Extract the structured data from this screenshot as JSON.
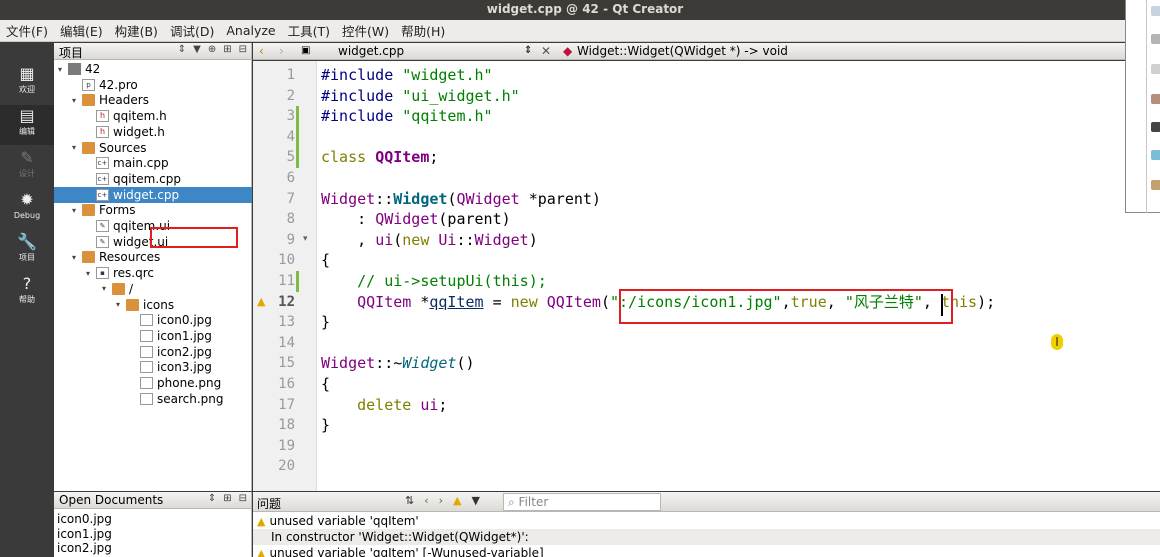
{
  "window": {
    "title": "widget.cpp @ 42 - Qt Creator"
  },
  "menubar": [
    "文件(F)",
    "编辑(E)",
    "构建(B)",
    "调试(D)",
    "Analyze",
    "工具(T)",
    "控件(W)",
    "帮助(H)"
  ],
  "modes": [
    {
      "label": "欢迎",
      "icon": "▦"
    },
    {
      "label": "编辑",
      "icon": "▤"
    },
    {
      "label": "设计",
      "icon": "✎"
    },
    {
      "label": "Debug",
      "icon": "✹"
    },
    {
      "label": "项目",
      "icon": "🔧"
    },
    {
      "label": "帮助",
      "icon": "?"
    }
  ],
  "project_panel": {
    "title": "项目",
    "tree": [
      {
        "label": "42",
        "kind": "proj",
        "depth": 0,
        "arrow": "▾"
      },
      {
        "label": "42.pro",
        "kind": "pro",
        "depth": 1,
        "arrow": ""
      },
      {
        "label": "Headers",
        "kind": "folder",
        "depth": 1,
        "arrow": "▾"
      },
      {
        "label": "qqitem.h",
        "kind": "h",
        "depth": 2,
        "arrow": ""
      },
      {
        "label": "widget.h",
        "kind": "h",
        "depth": 2,
        "arrow": ""
      },
      {
        "label": "Sources",
        "kind": "folder",
        "depth": 1,
        "arrow": "▾"
      },
      {
        "label": "main.cpp",
        "kind": "cpp",
        "depth": 2,
        "arrow": ""
      },
      {
        "label": "qqitem.cpp",
        "kind": "cpp",
        "depth": 2,
        "arrow": ""
      },
      {
        "label": "widget.cpp",
        "kind": "cpp",
        "depth": 2,
        "arrow": "",
        "selected": true
      },
      {
        "label": "Forms",
        "kind": "folder",
        "depth": 1,
        "arrow": "▾"
      },
      {
        "label": "qqitem.ui",
        "kind": "ui",
        "depth": 2,
        "arrow": ""
      },
      {
        "label": "widget.ui",
        "kind": "ui",
        "depth": 2,
        "arrow": ""
      },
      {
        "label": "Resources",
        "kind": "folder",
        "depth": 1,
        "arrow": "▾"
      },
      {
        "label": "res.qrc",
        "kind": "qrc",
        "depth": 2,
        "arrow": "▾"
      },
      {
        "label": "/",
        "kind": "folder",
        "depth": 3,
        "arrow": "▾"
      },
      {
        "label": "icons",
        "kind": "folder",
        "depth": 4,
        "arrow": "▾"
      },
      {
        "label": "icon0.jpg",
        "kind": "img",
        "depth": 5,
        "arrow": ""
      },
      {
        "label": "icon1.jpg",
        "kind": "img",
        "depth": 5,
        "arrow": ""
      },
      {
        "label": "icon2.jpg",
        "kind": "img",
        "depth": 5,
        "arrow": ""
      },
      {
        "label": "icon3.jpg",
        "kind": "img",
        "depth": 5,
        "arrow": ""
      },
      {
        "label": "phone.png",
        "kind": "img",
        "depth": 5,
        "arrow": ""
      },
      {
        "label": "search.png",
        "kind": "img",
        "depth": 5,
        "arrow": ""
      }
    ]
  },
  "editor": {
    "file": "widget.cpp",
    "symbol": "Widget::Widget(QWidget *) -> void",
    "current_line": 12,
    "lines": [
      {
        "n": "1",
        "html": "<span class='pp'>#include</span> <span class='str'>\"widget.h\"</span>"
      },
      {
        "n": "2",
        "html": "<span class='pp'>#include</span> <span class='str'>\"ui_widget.h\"</span>"
      },
      {
        "n": "3",
        "html": "<span class='pp'>#include</span> <span class='str'>\"qqitem.h\"</span>"
      },
      {
        "n": "4",
        "html": ""
      },
      {
        "n": "5",
        "html": "<span class='kw'>class</span> <span class='ty bold'>QQItem</span>;"
      },
      {
        "n": "6",
        "html": ""
      },
      {
        "n": "7",
        "html": "<span class='ty'>Widget</span>::<span class='fn'>Widget</span>(<span class='ty'>QWidget</span> *parent)"
      },
      {
        "n": "8",
        "html": "    : <span class='ty'>QWidget</span>(parent)"
      },
      {
        "n": "9",
        "html": "    , <span class='ty'>ui</span>(<span class='kw'>new</span> <span class='ty'>Ui</span>::<span class='ty'>Widget</span>)"
      },
      {
        "n": "10",
        "html": "{"
      },
      {
        "n": "11",
        "html": "    <span class='cm'>// ui->setupUi(this);</span>"
      },
      {
        "n": "12",
        "html": "    <span class='ty'>QQItem</span> *<span class='var'>qqItem</span> = <span class='kw'>new</span> <span class='ty'>QQItem</span>(<span class='str'>\":/icons/icon1.jpg\"</span>,<span class='kw'>true</span>, <span class='str'>\"风子兰特\"</span>, <span class='kw'>this</span>);"
      },
      {
        "n": "13",
        "html": "}"
      },
      {
        "n": "14",
        "html": ""
      },
      {
        "n": "15",
        "html": "<span class='ty'>Widget</span>::~<span class='it'>Widget</span>()"
      },
      {
        "n": "16",
        "html": "{"
      },
      {
        "n": "17",
        "html": "    <span class='kw'>delete</span> <span class='ty'>ui</span>;"
      },
      {
        "n": "18",
        "html": "}"
      },
      {
        "n": "19",
        "html": ""
      },
      {
        "n": "20",
        "html": ""
      }
    ]
  },
  "open_documents": {
    "title": "Open Documents",
    "items": [
      "icon0.jpg",
      "icon1.jpg",
      "icon2.jpg"
    ]
  },
  "issues": {
    "title": "问题",
    "filter_placeholder": "Filter",
    "items": [
      {
        "text": "unused variable 'qqItem'",
        "warn": true
      },
      {
        "text": "In constructor 'Widget::Widget(QWidget*)':",
        "warn": false
      },
      {
        "text": "unused variable 'qqItem' [-Wunused-variable]",
        "warn": true
      }
    ]
  }
}
